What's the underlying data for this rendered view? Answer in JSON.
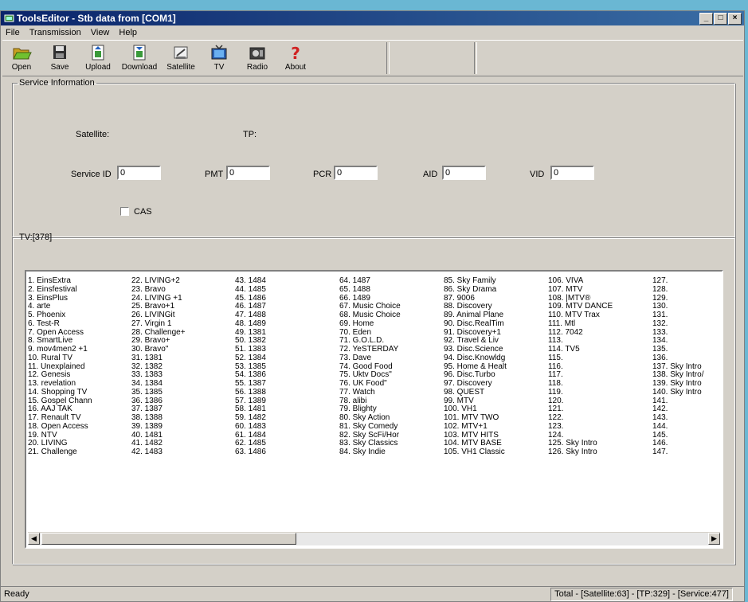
{
  "window": {
    "title": "ToolsEditor - Stb data from [COM1]",
    "controls": {
      "minimize": "_",
      "maximize": "□",
      "close": "×"
    }
  },
  "menu": [
    "File",
    "Transmission",
    "View",
    "Help"
  ],
  "toolbar": {
    "buttons": [
      {
        "label": "Open",
        "icon": "folder-open-icon"
      },
      {
        "label": "Save",
        "icon": "save-icon"
      },
      {
        "label": "Upload",
        "icon": "upload-icon"
      },
      {
        "label": "Download",
        "icon": "download-icon"
      },
      {
        "label": "Satellite",
        "icon": "satellite-icon"
      },
      {
        "label": "TV",
        "icon": "tv-icon"
      },
      {
        "label": "Radio",
        "icon": "radio-icon"
      },
      {
        "label": "About",
        "icon": "question-icon"
      }
    ]
  },
  "service_info": {
    "legend": "Service Information",
    "satellite_label": "Satellite:",
    "tp_label": "TP:",
    "service_id_label": "Service ID",
    "service_id_value": "0",
    "pmt_label": "PMT",
    "pmt_value": "0",
    "pcr_label": "PCR",
    "pcr_value": "0",
    "aid_label": "AID",
    "aid_value": "0",
    "vid_label": "VID",
    "vid_value": "0",
    "cas_label": "CAS",
    "cas_checked": false
  },
  "tv_list": {
    "legend": "TV:[378]",
    "columns": [
      [
        "1. EinsExtra",
        "2. Einsfestival",
        "3. EinsPlus",
        "4. arte",
        "5. Phoenix",
        "6. Test-R",
        "7. Open Access",
        "8. SmartLive",
        "9. mov4men2 +1",
        "10. Rural TV",
        "11. Unexplained",
        "12. Genesis",
        "13. revelation",
        "14. Shopping TV",
        "15. Gospel Chann",
        "16. AAJ TAK",
        "17. Renault TV",
        "18. Open Access",
        "19. NTV",
        "20. LIVING",
        "21. Challenge"
      ],
      [
        "22. LIVING+2",
        "23. Bravo",
        "24. LIVING +1",
        "25. Bravo+1",
        "26. LIVINGit",
        "27. Virgin 1",
        "28. Challenge+",
        "29. Bravo+",
        "30. Bravo\"",
        "31. 1381",
        "32. 1382",
        "33. 1383",
        "34. 1384",
        "35. 1385",
        "36. 1386",
        "37. 1387",
        "38. 1388",
        "39. 1389",
        "40. 1481",
        "41. 1482",
        "42. 1483"
      ],
      [
        "43. 1484",
        "44. 1485",
        "45. 1486",
        "46. 1487",
        "47. 1488",
        "48. 1489",
        "49. 1381",
        "50. 1382",
        "51. 1383",
        "52. 1384",
        "53. 1385",
        "54. 1386",
        "55. 1387",
        "56. 1388",
        "57. 1389",
        "58. 1481",
        "59. 1482",
        "60. 1483",
        "61. 1484",
        "62. 1485",
        "63. 1486"
      ],
      [
        "64. 1487",
        "65. 1488",
        "66. 1489",
        "67. Music Choice",
        "68. Music Choice",
        "69. Home",
        "70. Eden",
        "71. G.O.L.D.",
        "72. YeSTERDAY",
        "73. Dave",
        "74. Good Food",
        "75. Uktv Docs\"",
        "76. UK Food\"",
        "77. Watch",
        "78. alibi",
        "79. Blighty",
        "80. Sky Action",
        "81. Sky Comedy",
        "82. Sky ScFi/Hor",
        "83. Sky Classics",
        "84. Sky Indie"
      ],
      [
        "85. Sky Family",
        "86. Sky Drama",
        "87. 9006",
        "88. Discovery",
        "89. Animal Plane",
        "90. Disc.RealTim",
        "91. Discovery+1",
        "92. Travel & Liv",
        "93. Disc.Science",
        "94. Disc.Knowldg",
        "95. Home & Healt",
        "96. Disc.Turbo",
        "97. Discovery",
        "98. QUEST",
        "99. MTV",
        "100. VH1",
        "101. MTV TWO",
        "102. MTV+1",
        "103. MTV HITS",
        "104. MTV BASE",
        "105. VH1 Classic"
      ],
      [
        "106. VIVA",
        "107. MTV",
        "108. |MTV®",
        "109. MTV DANCE",
        "110. MTV Trax",
        "111. Mtl",
        "112. 7042",
        "113.",
        "114. TV5",
        "115.",
        "116.",
        "117.",
        "118.",
        "119.",
        "120.",
        "121.",
        "122.",
        "123.",
        "124.",
        "125. Sky Intro",
        "126. Sky Intro"
      ],
      [
        "127.",
        "128.",
        "129.",
        "130.",
        "131.",
        "132.",
        "133.",
        "134.",
        "135.",
        "136.",
        "137. Sky Intro",
        "138. Sky Intro/",
        "139. Sky Intro",
        "140. Sky Intro",
        "141.",
        "142.",
        "143.",
        "144.",
        "145.",
        "146.",
        "147."
      ]
    ]
  },
  "status": {
    "left": "Ready",
    "right": "Total - [Satellite:63] - [TP:329] - [Service:477]"
  }
}
